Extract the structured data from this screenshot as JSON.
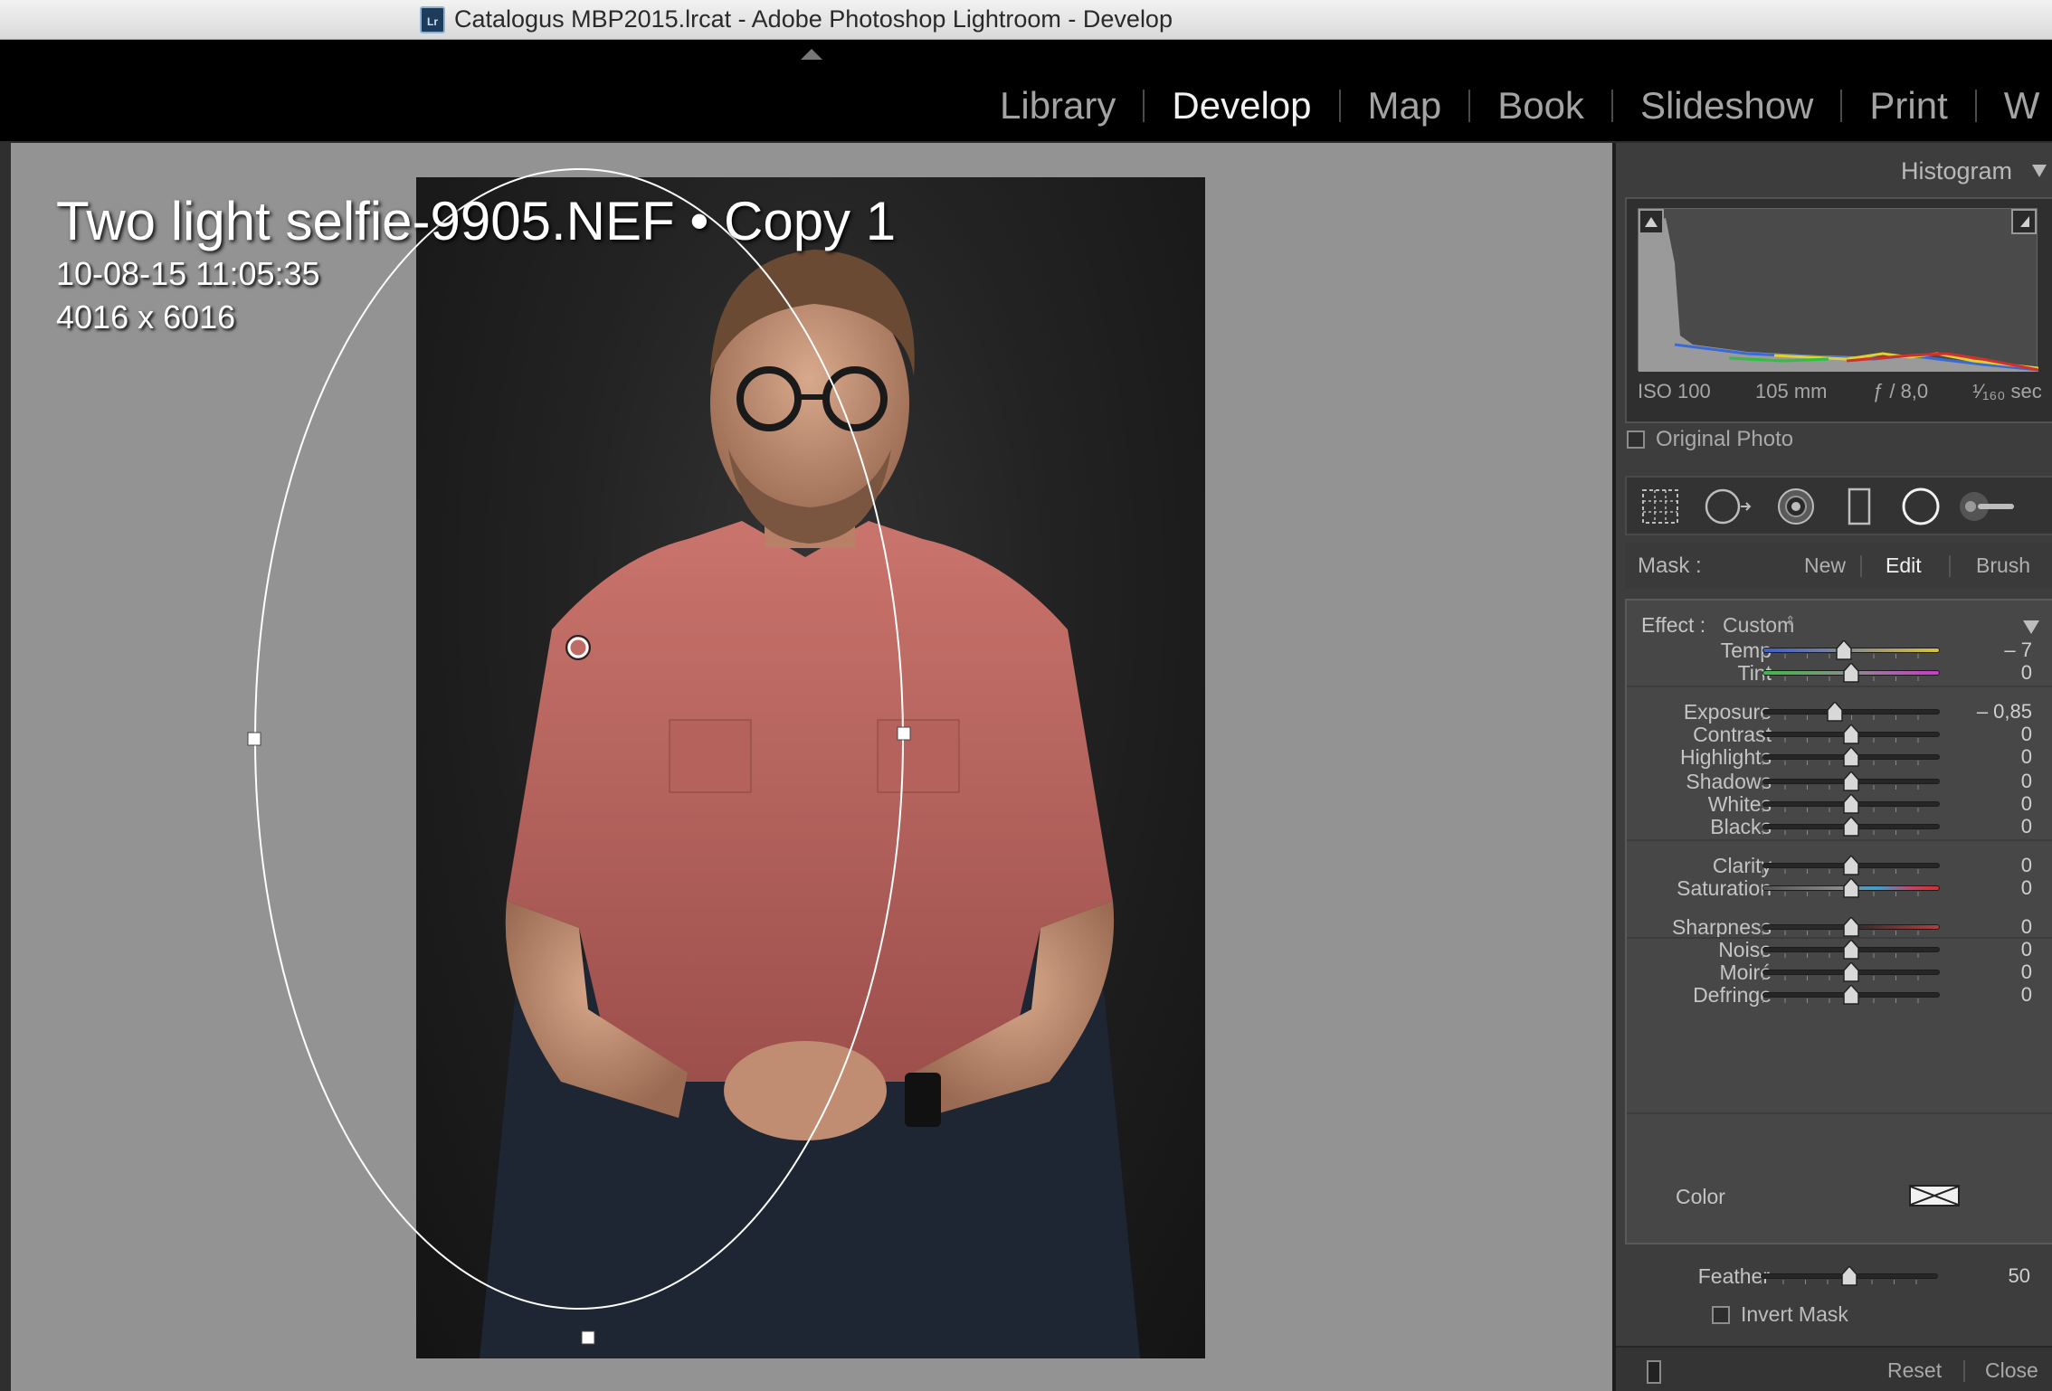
{
  "window": {
    "title": "Catalogus MBP2015.lrcat - Adobe Photoshop Lightroom - Develop",
    "app_icon_text": "Lr"
  },
  "modules": [
    "Library",
    "Develop",
    "Map",
    "Book",
    "Slideshow",
    "Print",
    "W"
  ],
  "active_module": "Develop",
  "photo_info": {
    "filename": "Two light selfie-9905.NEF  •  Copy 1",
    "datetime": "10-08-15 11:05:35",
    "dimensions": "4016 x 6016"
  },
  "histogram": {
    "title": "Histogram",
    "iso": "ISO 100",
    "focal_length": "105 mm",
    "aperture": "ƒ / 8,0",
    "shutter": "¹⁄₁₆₀ sec",
    "original_photo_label": "Original Photo"
  },
  "tools": [
    "crop-overlay-icon",
    "spot-removal-icon",
    "red-eye-icon",
    "graduated-filter-icon",
    "radial-filter-icon",
    "adjustment-brush-icon"
  ],
  "mask": {
    "label": "Mask :",
    "new": "New",
    "edit": "Edit",
    "brush": "Brush"
  },
  "effect": {
    "label": "Effect :",
    "value": "Custom",
    "sliders": [
      {
        "label": "Temp",
        "value": "– 7",
        "position": 0.46,
        "track": "temp"
      },
      {
        "label": "Tint",
        "value": "0",
        "position": 0.5,
        "track": "tint"
      },
      {
        "label": "Exposure",
        "value": "– 0,85",
        "position": 0.41,
        "track": "gray"
      },
      {
        "label": "Contrast",
        "value": "0",
        "position": 0.5,
        "track": "gray"
      },
      {
        "label": "Highlights",
        "value": "0",
        "position": 0.5,
        "track": "gray"
      },
      {
        "label": "Shadows",
        "value": "0",
        "position": 0.5,
        "track": "gray"
      },
      {
        "label": "Whites",
        "value": "0",
        "position": 0.5,
        "track": "gray"
      },
      {
        "label": "Blacks",
        "value": "0",
        "position": 0.5,
        "track": "gray"
      },
      {
        "label": "Clarity",
        "value": "0",
        "position": 0.5,
        "track": "gray"
      },
      {
        "label": "Saturation",
        "value": "0",
        "position": 0.5,
        "track": "saturation"
      },
      {
        "label": "Sharpness",
        "value": "0",
        "position": 0.5,
        "track": "sharpness"
      },
      {
        "label": "Noise",
        "value": "0",
        "position": 0.5,
        "track": "gray"
      },
      {
        "label": "Moiré",
        "value": "0",
        "position": 0.5,
        "track": "gray"
      },
      {
        "label": "Defringe",
        "value": "0",
        "position": 0.5,
        "track": "gray"
      }
    ],
    "color_label": "Color"
  },
  "feather": {
    "label": "Feather",
    "value": "50",
    "position": 0.5
  },
  "invert_mask_label": "Invert Mask",
  "footer": {
    "reset": "Reset",
    "close": "Close"
  },
  "colors": {
    "canvas_bg": "#939393",
    "panel_bg": "#3d3d3d",
    "active_text": "#f2f2f2",
    "inactive_text": "#a3a3a3"
  }
}
